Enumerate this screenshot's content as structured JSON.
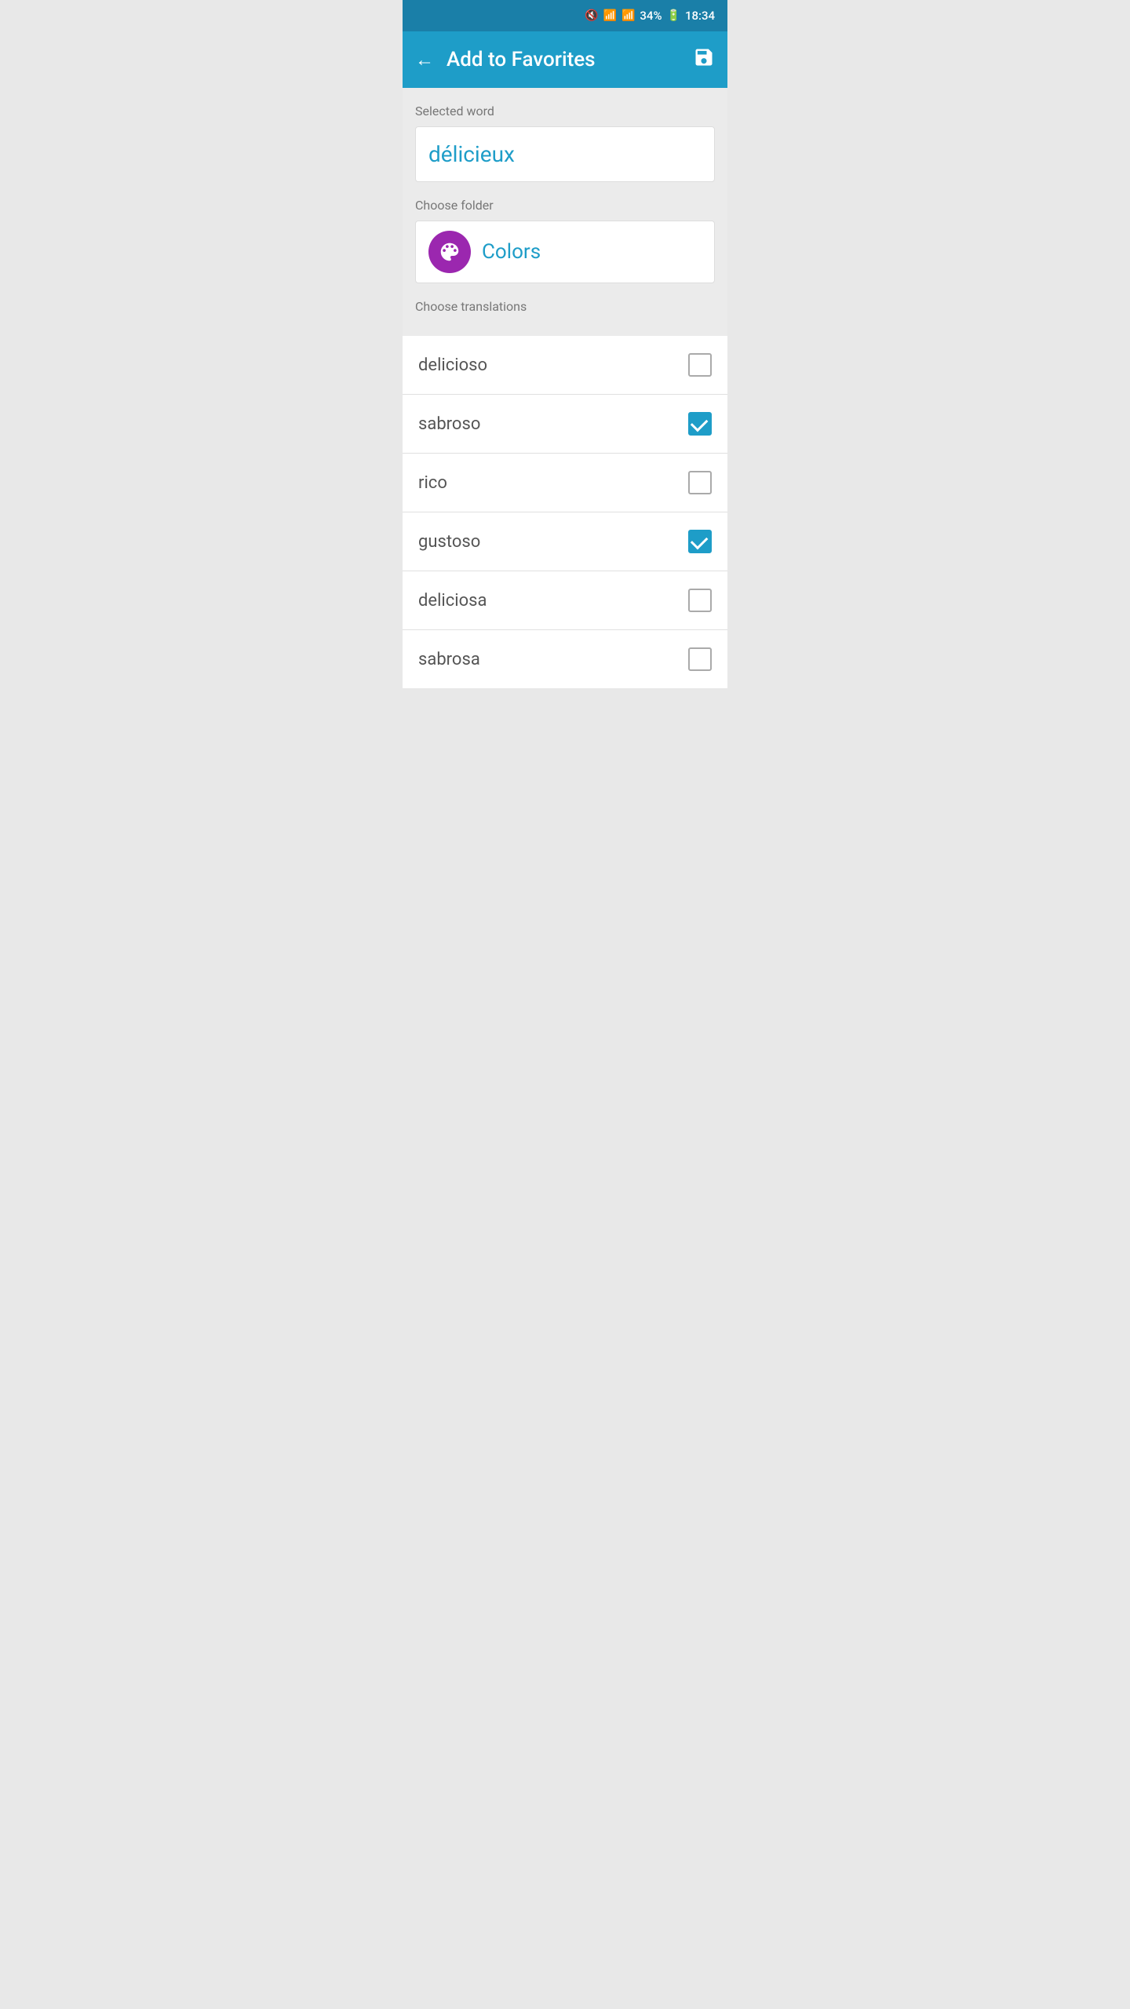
{
  "statusBar": {
    "battery": "34%",
    "time": "18:34"
  },
  "appBar": {
    "title": "Add to Favorites",
    "backLabel": "←",
    "saveLabel": "💾"
  },
  "form": {
    "selectedWordLabel": "Selected word",
    "selectedWord": "délicieux",
    "chooseFolderLabel": "Choose folder",
    "folderName": "Colors",
    "chooseTranslationsLabel": "Choose translations"
  },
  "translations": [
    {
      "word": "delicioso",
      "checked": false
    },
    {
      "word": "sabroso",
      "checked": true
    },
    {
      "word": "rico",
      "checked": false
    },
    {
      "word": "gustoso",
      "checked": true
    },
    {
      "word": "deliciosa",
      "checked": false
    },
    {
      "word": "sabrosa",
      "checked": false
    }
  ]
}
